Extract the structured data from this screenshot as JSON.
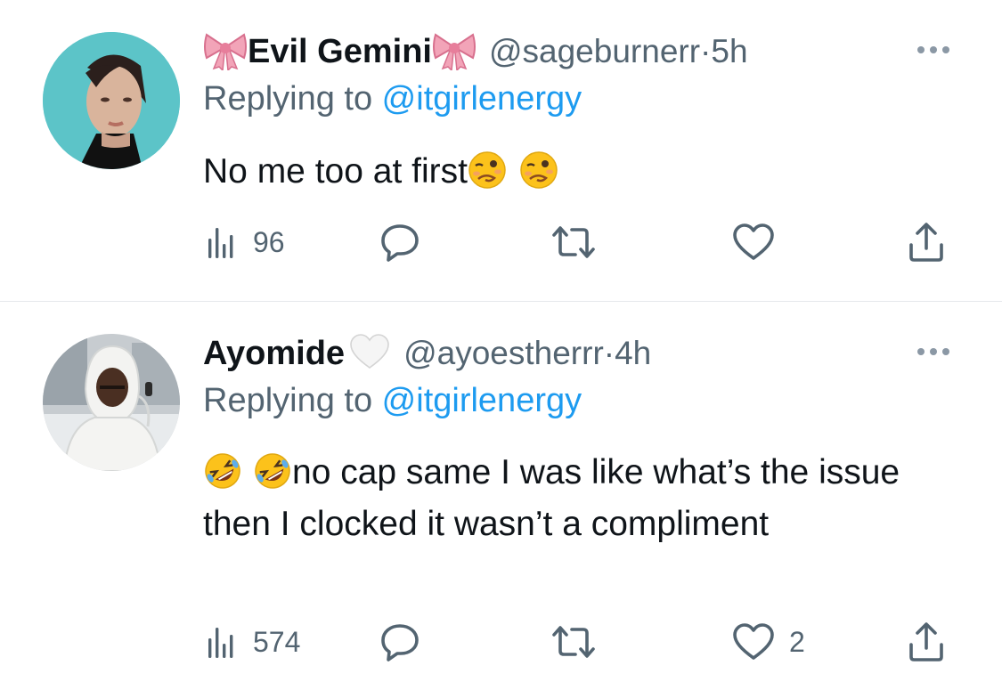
{
  "tweets": [
    {
      "name": "Evil Gemini",
      "handle": "@sageburnerr",
      "time_sep": " · ",
      "time": "5h",
      "replying_prefix": "Replying to ",
      "replying_to": "@itgirlenergy",
      "text": "No me too at first",
      "views": "96",
      "likes": "",
      "name_decoration": "pink-bow-emoji",
      "text_emojis": [
        "woozy-face-emoji",
        "woozy-face-emoji"
      ]
    },
    {
      "name": "Ayomide",
      "handle": "@ayoestherrr",
      "time_sep": " · ",
      "time": "4h",
      "replying_prefix": "Replying to ",
      "replying_to": "@itgirlenergy",
      "text": "no cap same I was like what’s the issue then I clocked it wasn’t a compliment",
      "views": "574",
      "likes": "2",
      "name_decoration": "white-heart-emoji",
      "text_emojis": [
        "rolling-on-floor-laughing-emoji",
        "rolling-on-floor-laughing-emoji"
      ]
    }
  ],
  "colors": {
    "text": "#0f1419",
    "secondary": "#536471",
    "link": "#1d9bf0",
    "divider": "#e6e9ec",
    "icon": "#536471"
  }
}
